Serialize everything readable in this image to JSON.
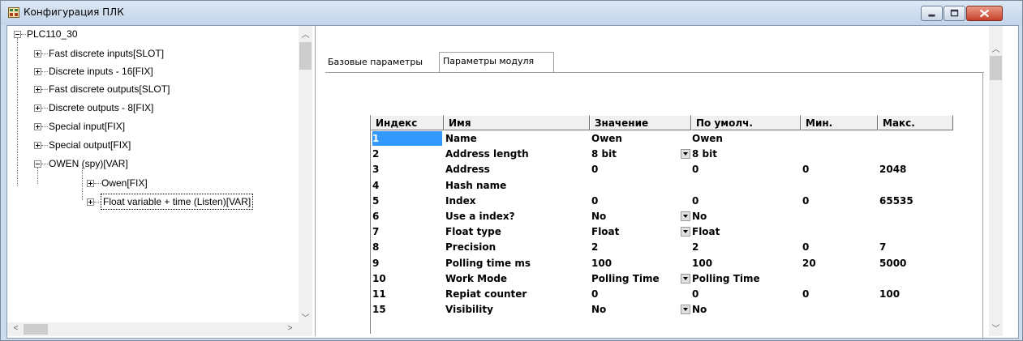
{
  "window": {
    "title": "Конфигурация ПЛК"
  },
  "tree": {
    "root": "PLC110_30",
    "items": [
      "Fast discrete inputs[SLOT]",
      "Discrete inputs - 16[FIX]",
      "Fast discrete outputs[SLOT]",
      "Discrete outputs - 8[FIX]",
      "Special input[FIX]",
      "Special output[FIX]",
      "OWEN (spy)[VAR]"
    ],
    "children": [
      "Owen[FIX]",
      "Float variable + time (Listen)[VAR]"
    ]
  },
  "tabs": [
    "Базовые параметры",
    "Параметры модуля"
  ],
  "grid": {
    "headers": [
      "Индекс",
      "Имя",
      "Значение",
      "По умолч.",
      "Мин.",
      "Макс."
    ],
    "rows": [
      {
        "idx": "1",
        "name": "Name",
        "value": "Owen",
        "def": "Owen",
        "min": "",
        "max": "",
        "dd": false
      },
      {
        "idx": "2",
        "name": "Address length",
        "value": "8 bit",
        "def": "8 bit",
        "min": "",
        "max": "",
        "dd": true
      },
      {
        "idx": "3",
        "name": "Address",
        "value": "0",
        "def": "0",
        "min": "0",
        "max": "2048",
        "dd": false
      },
      {
        "idx": "4",
        "name": "Hash name",
        "value": "",
        "def": "",
        "min": "",
        "max": "",
        "dd": false
      },
      {
        "idx": "5",
        "name": "Index",
        "value": "0",
        "def": "0",
        "min": "0",
        "max": "65535",
        "dd": false
      },
      {
        "idx": "6",
        "name": "Use a index?",
        "value": "No",
        "def": "No",
        "min": "",
        "max": "",
        "dd": true
      },
      {
        "idx": "7",
        "name": "Float type",
        "value": "Float",
        "def": "Float",
        "min": "",
        "max": "",
        "dd": true
      },
      {
        "idx": "8",
        "name": "Precision",
        "value": "2",
        "def": "2",
        "min": "0",
        "max": "7",
        "dd": false
      },
      {
        "idx": "9",
        "name": "Polling time ms",
        "value": "100",
        "def": "100",
        "min": "20",
        "max": "5000",
        "dd": false
      },
      {
        "idx": "10",
        "name": "Work Mode",
        "value": "Polling Time",
        "def": "Polling Time",
        "min": "",
        "max": "",
        "dd": true
      },
      {
        "idx": "11",
        "name": "Repiat counter",
        "value": "0",
        "def": "0",
        "min": "0",
        "max": "100",
        "dd": false
      },
      {
        "idx": "15",
        "name": "Visibility",
        "value": "No",
        "def": "No",
        "min": "",
        "max": "",
        "dd": true
      }
    ]
  }
}
